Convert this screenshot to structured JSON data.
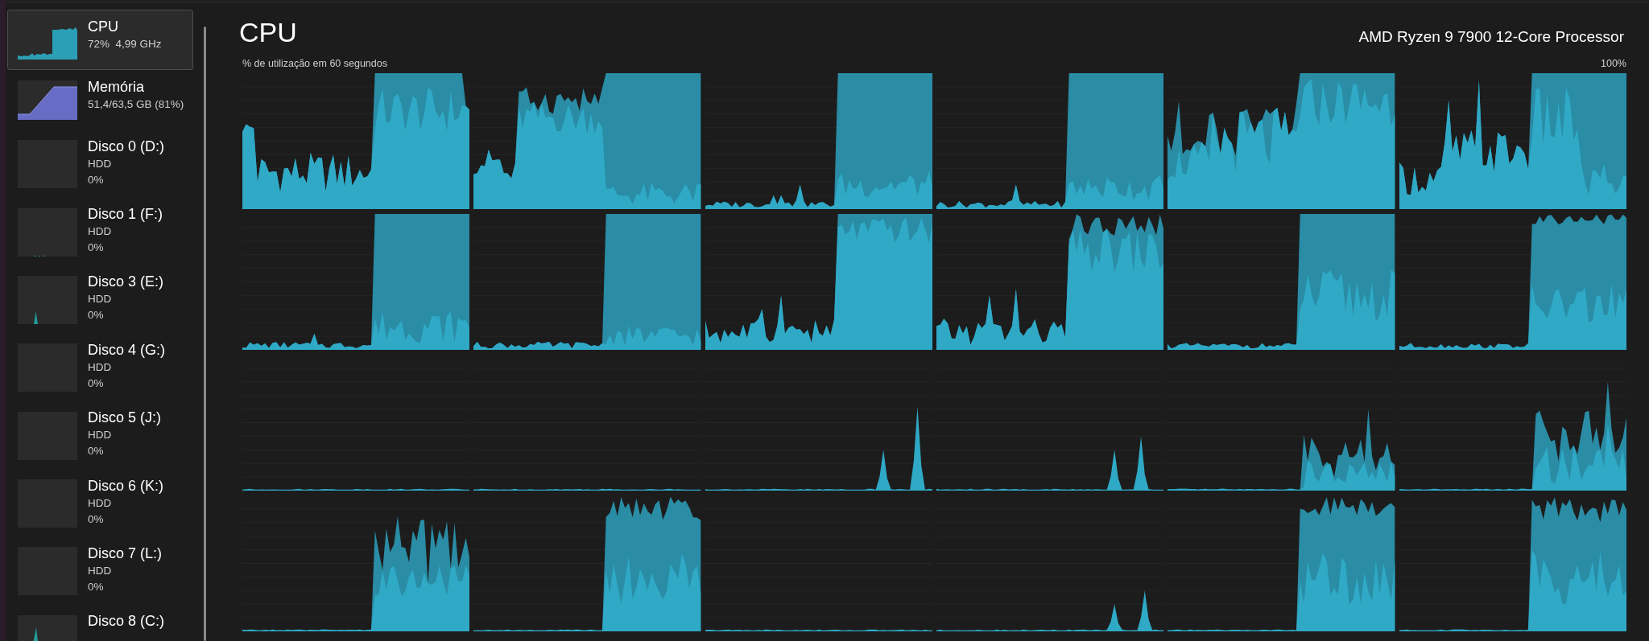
{
  "sidebar": {
    "items": [
      {
        "kind": "cpu",
        "name": "CPU",
        "details": [
          "72%  4,99 GHz"
        ],
        "selected": true
      },
      {
        "kind": "memory",
        "name": "Memória",
        "details": [
          "51,4/63,5 GB (81%)"
        ],
        "selected": false
      },
      {
        "kind": "disk",
        "name": "Disco 0 (D:)",
        "details": [
          "HDD",
          "0%"
        ],
        "selected": false
      },
      {
        "kind": "disk",
        "name": "Disco 1 (F:)",
        "details": [
          "HDD",
          "0%"
        ],
        "selected": false
      },
      {
        "kind": "disk",
        "name": "Disco 3 (E:)",
        "details": [
          "HDD",
          "0%"
        ],
        "selected": false
      },
      {
        "kind": "disk",
        "name": "Disco 4 (G:)",
        "details": [
          "HDD",
          "0%"
        ],
        "selected": false
      },
      {
        "kind": "disk",
        "name": "Disco 5 (J:)",
        "details": [
          "HDD",
          "0%"
        ],
        "selected": false
      },
      {
        "kind": "disk",
        "name": "Disco 6 (K:)",
        "details": [
          "HDD",
          "0%"
        ],
        "selected": false
      },
      {
        "kind": "disk",
        "name": "Disco 7 (L:)",
        "details": [
          "HDD",
          "0%"
        ],
        "selected": false
      },
      {
        "kind": "disk",
        "name": "Disco 8 (C:)",
        "selected": false
      }
    ]
  },
  "main": {
    "title": "CPU",
    "processor": "AMD Ryzen 9 7900 12-Core Processor",
    "graph_caption": "% de utilização em 60 segundos",
    "graph_max": "100%"
  }
}
